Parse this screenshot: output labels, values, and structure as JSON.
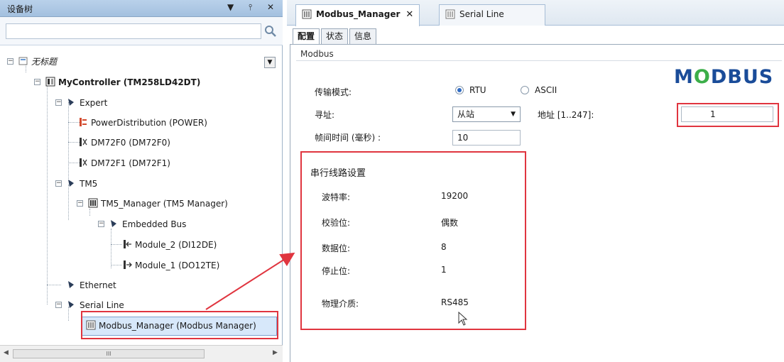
{
  "device_tree": {
    "title": "设备树",
    "pin_glyph": "▼",
    "autohide_glyph": "⫯",
    "close_glyph": "✕",
    "search": {
      "value": "",
      "placeholder": ""
    },
    "items": [
      {
        "label": "无标题",
        "icon": "project-icon"
      },
      {
        "label": "MyController (TM258LD42DT)",
        "icon": "controller-icon"
      },
      {
        "label": "Expert",
        "icon": "expert-icon"
      },
      {
        "label": "PowerDistribution (POWER)",
        "icon": "power-icon"
      },
      {
        "label": "DM72F0 (DM72F0)",
        "icon": "io-icon"
      },
      {
        "label": "DM72F1 (DM72F1)",
        "icon": "io-icon"
      },
      {
        "label": "TM5",
        "icon": "bus-icon"
      },
      {
        "label": "TM5_Manager (TM5 Manager)",
        "icon": "manager-icon"
      },
      {
        "label": "Embedded Bus",
        "icon": "bus-icon"
      },
      {
        "label": "Module_2 (DI12DE)",
        "icon": "module-icon"
      },
      {
        "label": "Module_1 (DO12TE)",
        "icon": "module-icon"
      },
      {
        "label": "Ethernet",
        "icon": "bus-icon"
      },
      {
        "label": "Serial Line",
        "icon": "bus-icon"
      },
      {
        "label": "Modbus_Manager (Modbus Manager)",
        "icon": "manager-icon"
      }
    ],
    "scroll_thumb": "III"
  },
  "editor": {
    "tabs": [
      {
        "label": "Modbus_Manager",
        "active": true,
        "close": "✕"
      },
      {
        "label": "Serial Line",
        "active": false
      }
    ],
    "sub_tabs": [
      "配置",
      "状态",
      "信息"
    ],
    "group": "Modbus",
    "logo": {
      "part1": "M",
      "part2": "O",
      "part3": "DBUS"
    },
    "transmission": {
      "label": "传输模式:",
      "options": [
        "RTU",
        "ASCII"
      ],
      "selected": "RTU"
    },
    "addressing": {
      "label": "寻址:",
      "value": "从站",
      "address_label": "地址 [1..247]:",
      "address_value": "1"
    },
    "frame_time": {
      "label": "帧间时间 (毫秒) :",
      "value": "10"
    },
    "serial_settings": {
      "title": "串行线路设置",
      "rows": [
        {
          "label": "波特率:",
          "value": "19200"
        },
        {
          "label": "校验位:",
          "value": "偶数"
        },
        {
          "label": "数据位:",
          "value": "8"
        },
        {
          "label": "停止位:",
          "value": "1"
        },
        {
          "label": "物理介质:",
          "value": "RS485"
        }
      ]
    }
  },
  "colors": {
    "highlight": "#e0353f",
    "selection": "#d7e8fa",
    "logo_blue": "#1a4c99",
    "logo_green": "#3cae49"
  }
}
